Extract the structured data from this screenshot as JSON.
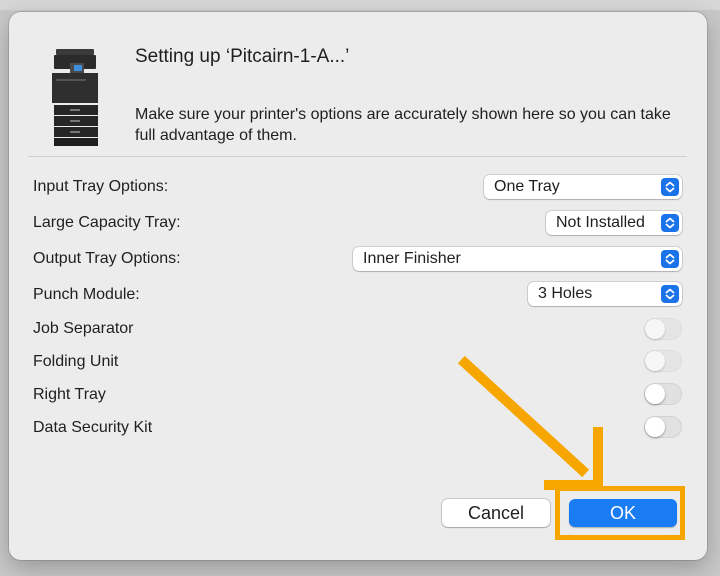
{
  "dialog": {
    "title": "Setting up ‘Pitcairn-1-A...’",
    "subtitle": "Make sure your printer's options are accurately shown here so you can take full advantage of them.",
    "printer_icon": "printer-icon"
  },
  "options": {
    "input_tray": {
      "label": "Input Tray Options:",
      "value": "One Tray"
    },
    "large_capacity": {
      "label": "Large Capacity Tray:",
      "value": "Not Installed"
    },
    "output_tray": {
      "label": "Output Tray Options:",
      "value": "Inner Finisher"
    },
    "punch": {
      "label": "Punch Module:",
      "value": "3 Holes"
    },
    "job_separator": {
      "label": "Job Separator",
      "on": false,
      "enabled": false
    },
    "folding_unit": {
      "label": "Folding Unit",
      "on": false,
      "enabled": false
    },
    "right_tray": {
      "label": "Right Tray",
      "on": false,
      "enabled": true
    },
    "data_security": {
      "label": "Data Security Kit",
      "on": false,
      "enabled": true
    }
  },
  "buttons": {
    "cancel": "Cancel",
    "ok": "OK"
  },
  "colors": {
    "accent": "#1a7cf2",
    "annotation": "#f7a600"
  }
}
